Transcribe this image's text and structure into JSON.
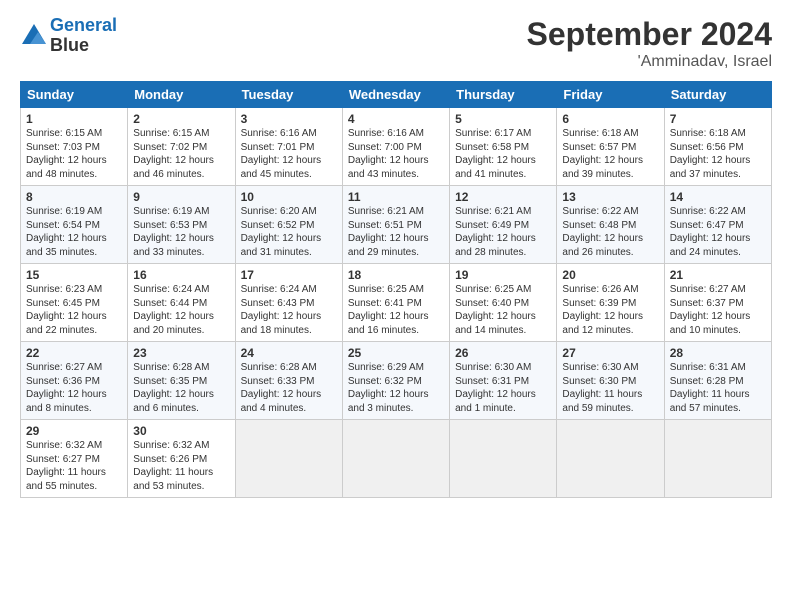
{
  "header": {
    "logo_line1": "General",
    "logo_line2": "Blue",
    "month": "September 2024",
    "location": "'Amminadav, Israel"
  },
  "weekdays": [
    "Sunday",
    "Monday",
    "Tuesday",
    "Wednesday",
    "Thursday",
    "Friday",
    "Saturday"
  ],
  "weeks": [
    [
      {
        "day": "1",
        "sunrise": "6:15 AM",
        "sunset": "7:03 PM",
        "daylight": "12 hours and 48 minutes."
      },
      {
        "day": "2",
        "sunrise": "6:15 AM",
        "sunset": "7:02 PM",
        "daylight": "12 hours and 46 minutes."
      },
      {
        "day": "3",
        "sunrise": "6:16 AM",
        "sunset": "7:01 PM",
        "daylight": "12 hours and 45 minutes."
      },
      {
        "day": "4",
        "sunrise": "6:16 AM",
        "sunset": "7:00 PM",
        "daylight": "12 hours and 43 minutes."
      },
      {
        "day": "5",
        "sunrise": "6:17 AM",
        "sunset": "6:58 PM",
        "daylight": "12 hours and 41 minutes."
      },
      {
        "day": "6",
        "sunrise": "6:18 AM",
        "sunset": "6:57 PM",
        "daylight": "12 hours and 39 minutes."
      },
      {
        "day": "7",
        "sunrise": "6:18 AM",
        "sunset": "6:56 PM",
        "daylight": "12 hours and 37 minutes."
      }
    ],
    [
      {
        "day": "8",
        "sunrise": "6:19 AM",
        "sunset": "6:54 PM",
        "daylight": "12 hours and 35 minutes."
      },
      {
        "day": "9",
        "sunrise": "6:19 AM",
        "sunset": "6:53 PM",
        "daylight": "12 hours and 33 minutes."
      },
      {
        "day": "10",
        "sunrise": "6:20 AM",
        "sunset": "6:52 PM",
        "daylight": "12 hours and 31 minutes."
      },
      {
        "day": "11",
        "sunrise": "6:21 AM",
        "sunset": "6:51 PM",
        "daylight": "12 hours and 29 minutes."
      },
      {
        "day": "12",
        "sunrise": "6:21 AM",
        "sunset": "6:49 PM",
        "daylight": "12 hours and 28 minutes."
      },
      {
        "day": "13",
        "sunrise": "6:22 AM",
        "sunset": "6:48 PM",
        "daylight": "12 hours and 26 minutes."
      },
      {
        "day": "14",
        "sunrise": "6:22 AM",
        "sunset": "6:47 PM",
        "daylight": "12 hours and 24 minutes."
      }
    ],
    [
      {
        "day": "15",
        "sunrise": "6:23 AM",
        "sunset": "6:45 PM",
        "daylight": "12 hours and 22 minutes."
      },
      {
        "day": "16",
        "sunrise": "6:24 AM",
        "sunset": "6:44 PM",
        "daylight": "12 hours and 20 minutes."
      },
      {
        "day": "17",
        "sunrise": "6:24 AM",
        "sunset": "6:43 PM",
        "daylight": "12 hours and 18 minutes."
      },
      {
        "day": "18",
        "sunrise": "6:25 AM",
        "sunset": "6:41 PM",
        "daylight": "12 hours and 16 minutes."
      },
      {
        "day": "19",
        "sunrise": "6:25 AM",
        "sunset": "6:40 PM",
        "daylight": "12 hours and 14 minutes."
      },
      {
        "day": "20",
        "sunrise": "6:26 AM",
        "sunset": "6:39 PM",
        "daylight": "12 hours and 12 minutes."
      },
      {
        "day": "21",
        "sunrise": "6:27 AM",
        "sunset": "6:37 PM",
        "daylight": "12 hours and 10 minutes."
      }
    ],
    [
      {
        "day": "22",
        "sunrise": "6:27 AM",
        "sunset": "6:36 PM",
        "daylight": "12 hours and 8 minutes."
      },
      {
        "day": "23",
        "sunrise": "6:28 AM",
        "sunset": "6:35 PM",
        "daylight": "12 hours and 6 minutes."
      },
      {
        "day": "24",
        "sunrise": "6:28 AM",
        "sunset": "6:33 PM",
        "daylight": "12 hours and 4 minutes."
      },
      {
        "day": "25",
        "sunrise": "6:29 AM",
        "sunset": "6:32 PM",
        "daylight": "12 hours and 3 minutes."
      },
      {
        "day": "26",
        "sunrise": "6:30 AM",
        "sunset": "6:31 PM",
        "daylight": "12 hours and 1 minute."
      },
      {
        "day": "27",
        "sunrise": "6:30 AM",
        "sunset": "6:30 PM",
        "daylight": "11 hours and 59 minutes."
      },
      {
        "day": "28",
        "sunrise": "6:31 AM",
        "sunset": "6:28 PM",
        "daylight": "11 hours and 57 minutes."
      }
    ],
    [
      {
        "day": "29",
        "sunrise": "6:32 AM",
        "sunset": "6:27 PM",
        "daylight": "11 hours and 55 minutes."
      },
      {
        "day": "30",
        "sunrise": "6:32 AM",
        "sunset": "6:26 PM",
        "daylight": "11 hours and 53 minutes."
      },
      null,
      null,
      null,
      null,
      null
    ]
  ]
}
